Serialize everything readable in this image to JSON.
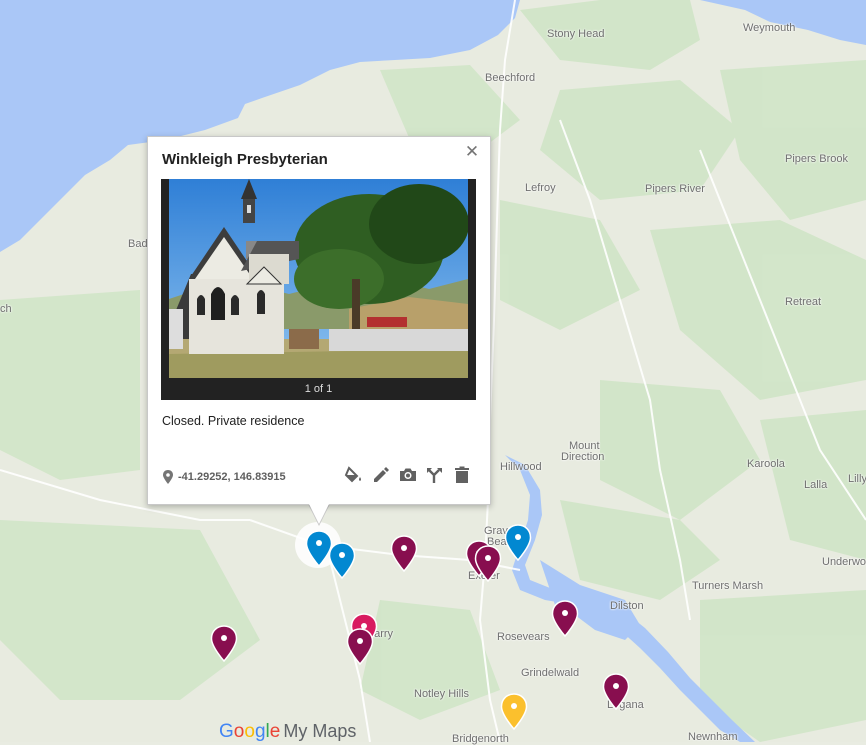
{
  "map": {
    "places": [
      {
        "name": "Weymouth"
      },
      {
        "name": "Stony Head"
      },
      {
        "name": "Beechford"
      },
      {
        "name": "Pipers Brook"
      },
      {
        "name": "Lefroy"
      },
      {
        "name": "Pipers River"
      },
      {
        "name": "Bad"
      },
      {
        "name": "ch"
      },
      {
        "name": "Retreat"
      },
      {
        "name": "Mount"
      },
      {
        "name": "Direction"
      },
      {
        "name": "Hillwood"
      },
      {
        "name": "Karoola"
      },
      {
        "name": "Lilly"
      },
      {
        "name": "Lalla"
      },
      {
        "name": "Grave"
      },
      {
        "name": "Beac"
      },
      {
        "name": "Exeter"
      },
      {
        "name": "Turners Marsh"
      },
      {
        "name": "Underwo"
      },
      {
        "name": "Dilston"
      },
      {
        "name": "garry"
      },
      {
        "name": "Rosevears"
      },
      {
        "name": "Grindelwald"
      },
      {
        "name": "Notley Hills"
      },
      {
        "name": "Legana"
      },
      {
        "name": "Bridgenorth"
      },
      {
        "name": "Newnham"
      }
    ],
    "markers": [
      {
        "id": "winkleigh",
        "color": "#0288d1",
        "selected": true
      },
      {
        "id": "m2",
        "color": "#0288d1"
      },
      {
        "id": "m3",
        "color": "#880e4f"
      },
      {
        "id": "m4",
        "color": "#880e4f"
      },
      {
        "id": "m5",
        "color": "#880e4f"
      },
      {
        "id": "m6",
        "color": "#0288d1"
      },
      {
        "id": "m7",
        "color": "#880e4f"
      },
      {
        "id": "m8",
        "color": "#d81b60"
      },
      {
        "id": "m9",
        "color": "#880e4f"
      },
      {
        "id": "m10",
        "color": "#880e4f"
      },
      {
        "id": "m11",
        "color": "#880e4f"
      },
      {
        "id": "m12",
        "color": "#fbc02d"
      }
    ]
  },
  "popup": {
    "title": "Winkleigh Presbyterian",
    "close_icon": "close-icon",
    "photo_counter": "1 of 1",
    "description": "Closed. Private residence",
    "coordinates": "-41.29252, 146.83915",
    "tools": [
      "paint-bucket-icon",
      "edit-icon",
      "camera-icon",
      "directions-icon",
      "delete-icon"
    ]
  },
  "branding": {
    "google": "Google",
    "product": "My Maps"
  }
}
